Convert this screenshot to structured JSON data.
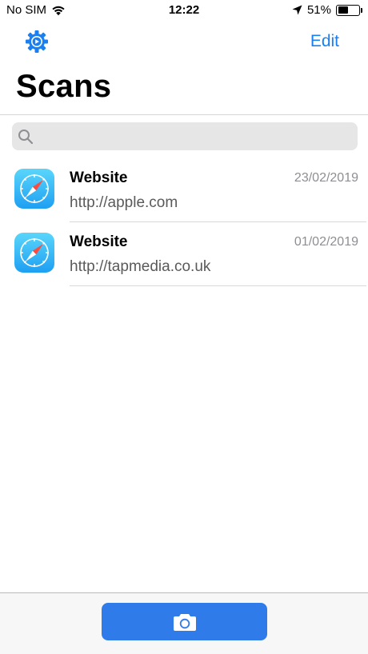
{
  "status_bar": {
    "carrier": "No SIM",
    "time": "12:22",
    "battery_percent": "51%",
    "battery_level": 0.51
  },
  "nav": {
    "edit_label": "Edit",
    "title": "Scans"
  },
  "search": {
    "placeholder": "",
    "value": ""
  },
  "scans": [
    {
      "title": "Website",
      "url": "http://apple.com",
      "date": "23/02/2019",
      "icon": "safari-icon"
    },
    {
      "title": "Website",
      "url": "http://tapmedia.co.uk",
      "date": "01/02/2019",
      "icon": "safari-icon"
    }
  ],
  "toolbar": {
    "camera_icon": "camera-icon"
  },
  "colors": {
    "accent": "#1a7ff0",
    "button": "#2f7bea",
    "safari_gradient_top": "#5ad6fb",
    "safari_gradient_bottom": "#1e9ff2"
  }
}
